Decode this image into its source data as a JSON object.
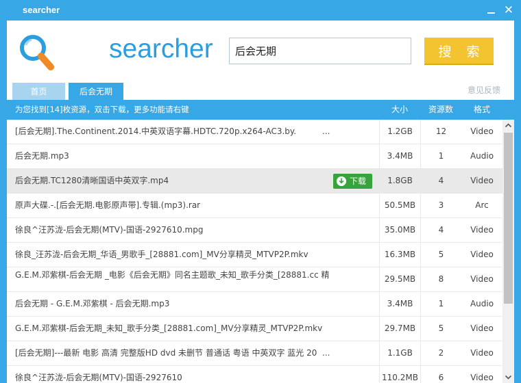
{
  "window": {
    "title": "searcher"
  },
  "brand": {
    "name": "searcher"
  },
  "search": {
    "value": "后会无期",
    "button_label": "搜 索"
  },
  "tabs": [
    {
      "label": "首页"
    },
    {
      "label": "后会无期"
    }
  ],
  "feedback_label": "意见反馈",
  "results_header": {
    "hint": "为您找到[14]枚资源，双击下载，更多功能请右键",
    "col_size": "大小",
    "col_count": "资源数",
    "col_format": "格式"
  },
  "download_label": "下载",
  "results": [
    {
      "name": "[后会无期].The.Continent.2014.中英双语字幕.HDTC.720p.x264-AC3.by.",
      "more": "...",
      "size": "1.2GB",
      "count": "12",
      "format": "Video"
    },
    {
      "name": "后会无期.mp3",
      "more": "",
      "size": "3.4MB",
      "count": "1",
      "format": "Audio"
    },
    {
      "name": "后会无期.TC1280清晰国语中英双字.mp4",
      "more": "",
      "size": "1.8GB",
      "count": "4",
      "format": "Video"
    },
    {
      "name": "原声大碟.-.[后会无期.电影原声带].专辑.(mp3).rar",
      "more": "",
      "size": "50.5MB",
      "count": "3",
      "format": "Arc"
    },
    {
      "name": "徐良^汪苏泷-后会无期(MTV)-国语-2927610.mpg",
      "more": "",
      "size": "35.0MB",
      "count": "4",
      "format": "Video"
    },
    {
      "name": "徐良_汪苏泷-后会无期_华语_男歌手_[28881.com]_MV分享精灵_MTVP2P.mkv",
      "more": "",
      "size": "16.3MB",
      "count": "5",
      "format": "Video"
    },
    {
      "name": "G.E.M.邓紫棋-后会无期 _电影《后会无期》同名主题歌_未知_歌手分类_[28881.cc 精",
      "more": "",
      "size": "29.5MB",
      "count": "8",
      "format": "Video"
    },
    {
      "name": "后会无期 - G.E.M.邓紫棋 - 后会无期.mp3",
      "more": "",
      "size": "3.4MB",
      "count": "1",
      "format": "Audio"
    },
    {
      "name": "G.E.M.邓紫棋-后会无期_未知_歌手分类_[28881.com]_MV分享精灵_MTVP2P.mkv",
      "more": "",
      "size": "29.7MB",
      "count": "5",
      "format": "Video"
    },
    {
      "name": "[后会无期]---最新 电影 高清 完整版HD dvd 未删节 普通话 粤语 中英双字 蓝光 20",
      "more": "...",
      "size": "1.1GB",
      "count": "2",
      "format": "Video"
    },
    {
      "name": "徐良^汪苏泷-后会无期(MTV)-国语-2927610",
      "more": "",
      "size": "110.2MB",
      "count": "6",
      "format": "Video"
    }
  ],
  "colors": {
    "titlebar": "#38a7e6",
    "brand": "#2b9ee0",
    "search_button": "#f4c430",
    "download_button": "#36a33c",
    "row_highlight": "#e9e9e9"
  },
  "icons": {
    "logo": "magnifier-icon",
    "minimize": "minimize-icon",
    "close": "close-icon",
    "download": "download-arrow-icon"
  }
}
